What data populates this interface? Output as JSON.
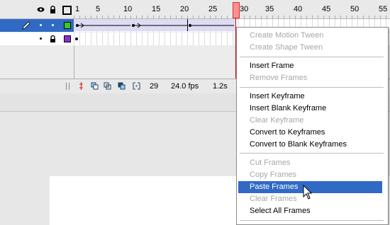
{
  "ruler": {
    "ticks": [
      "1",
      "5",
      "10",
      "15",
      "20",
      "25",
      "30",
      "35",
      "40",
      "45",
      "50",
      "55"
    ],
    "current_frame": "30"
  },
  "layers": [
    {
      "selected": true,
      "color": "#2ecc2e",
      "tween_end_frame": "29"
    },
    {
      "selected": false,
      "color": "#8e2fc9"
    }
  ],
  "status": {
    "current_frame": "29",
    "fps": "24.0 fps",
    "elapsed": "1.2s"
  },
  "menu": {
    "groups": [
      [
        {
          "label": "Create Motion Tween",
          "enabled": false
        },
        {
          "label": "Create Shape Tween",
          "enabled": false
        }
      ],
      [
        {
          "label": "Insert Frame",
          "enabled": true
        },
        {
          "label": "Remove Frames",
          "enabled": false
        }
      ],
      [
        {
          "label": "Insert Keyframe",
          "enabled": true
        },
        {
          "label": "Insert Blank Keyframe",
          "enabled": true
        },
        {
          "label": "Clear Keyframe",
          "enabled": false
        },
        {
          "label": "Convert to Keyframes",
          "enabled": true
        },
        {
          "label": "Convert to Blank Keyframes",
          "enabled": true
        }
      ],
      [
        {
          "label": "Cut Frames",
          "enabled": false
        },
        {
          "label": "Copy Frames",
          "enabled": false
        },
        {
          "label": "Paste Frames",
          "enabled": true,
          "selected": true
        },
        {
          "label": "Clear Frames",
          "enabled": false
        },
        {
          "label": "Select All Frames",
          "enabled": true
        }
      ]
    ]
  },
  "colors": {
    "selection": "#316ac5",
    "playhead": "#ff8f8f"
  }
}
